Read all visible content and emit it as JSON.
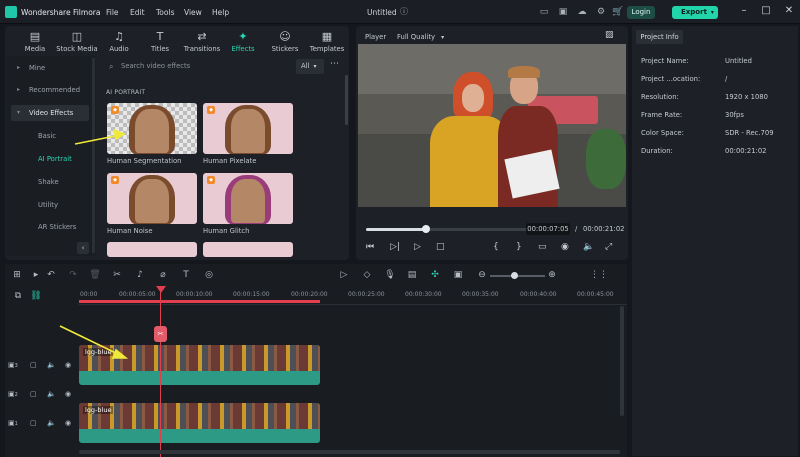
{
  "app": {
    "name": "Wondershare Filmora",
    "doc_title": "Untitled"
  },
  "menu": [
    "File",
    "Edit",
    "Tools",
    "View",
    "Help"
  ],
  "topbar": {
    "login": "Login",
    "export": "Export"
  },
  "tabs": [
    {
      "label": "Media",
      "icon": "media-icon"
    },
    {
      "label": "Stock Media",
      "icon": "stock-media-icon"
    },
    {
      "label": "Audio",
      "icon": "audio-icon"
    },
    {
      "label": "Titles",
      "icon": "titles-icon"
    },
    {
      "label": "Transitions",
      "icon": "transitions-icon"
    },
    {
      "label": "Effects",
      "icon": "effects-icon"
    },
    {
      "label": "Stickers",
      "icon": "stickers-icon"
    },
    {
      "label": "Templates",
      "icon": "templates-icon"
    }
  ],
  "categories": {
    "items": [
      "Mine",
      "Recommended",
      "Video Effects"
    ],
    "sub": [
      "Basic",
      "AI Portrait",
      "Shake",
      "Utility",
      "AR Stickers"
    ]
  },
  "effects": {
    "search_placeholder": "Search video effects",
    "filter": "All",
    "section": "AI PORTRAIT",
    "items": [
      "Human Segmentation",
      "Human Pixelate",
      "Human Noise",
      "Human Glitch"
    ]
  },
  "player": {
    "label": "Player",
    "quality": "Full Quality",
    "current_time": "00:00:07:05",
    "separator": "/",
    "total_time": "00:00:21:02",
    "progress": 0.34
  },
  "project_info": {
    "tab": "Project Info",
    "rows": [
      {
        "key": "Project Name:",
        "value": "Untitled"
      },
      {
        "key": "Project ...ocation:",
        "value": "/"
      },
      {
        "key": "Resolution:",
        "value": "1920 x 1080"
      },
      {
        "key": "Frame Rate:",
        "value": "30fps"
      },
      {
        "key": "Color Space:",
        "value": "SDR - Rec.709"
      },
      {
        "key": "Duration:",
        "value": "00:00:21:02"
      }
    ]
  },
  "timeline": {
    "ruler": [
      "00:00",
      "00:00:05:00",
      "00:00:10:00",
      "00:00:15:00",
      "00:00:20:00",
      "00:00:25:00",
      "00:00:30:00",
      "00:00:35:00",
      "00:00:40:00",
      "00:00:45:00"
    ],
    "tracks": [
      {
        "number": "3",
        "clip": "lgg-blue"
      },
      {
        "number": "2",
        "clip": ""
      },
      {
        "number": "1",
        "clip": "lgg-blue"
      }
    ]
  },
  "colors": {
    "accent": "#2ad7b2",
    "playhead": "#e13e4f",
    "clip": "#2c9a84",
    "annotation": "#f0e93a"
  }
}
